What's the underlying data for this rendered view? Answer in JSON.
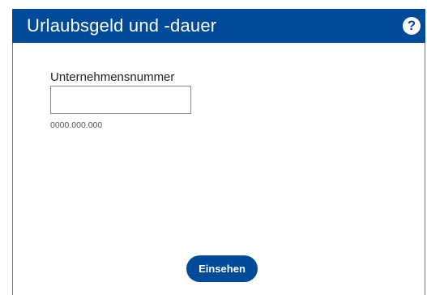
{
  "dialog": {
    "title": "Urlaubsgeld und -dauer",
    "help_label": "?"
  },
  "form": {
    "company_number": {
      "label": "Unternehmensnummer",
      "value": "",
      "hint": "0000.000.000"
    },
    "submit_label": "Einsehen"
  },
  "colors": {
    "brand": "#004a99",
    "background": "#ffffff"
  }
}
